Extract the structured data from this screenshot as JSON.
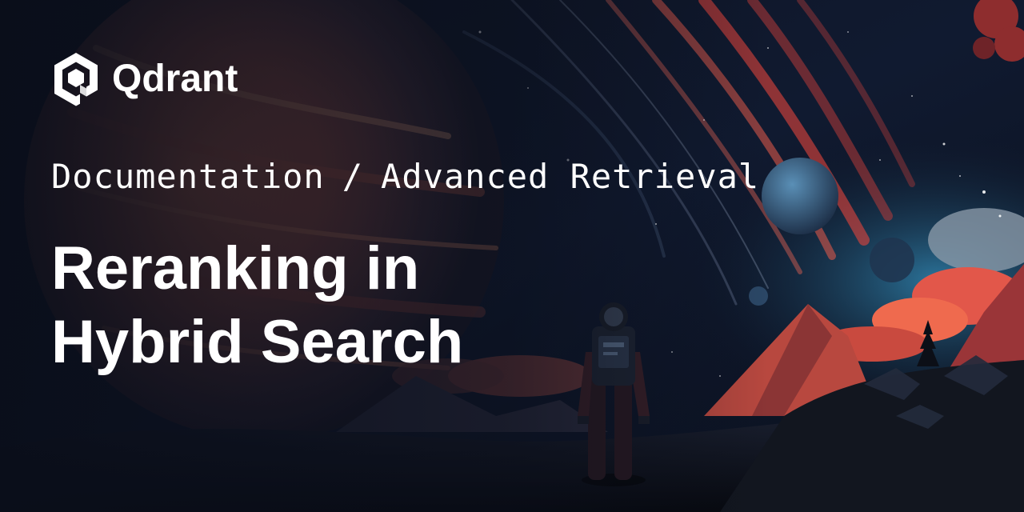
{
  "brand": {
    "name": "Qdrant",
    "logo_icon": "qdrant-hexagon-logo-icon"
  },
  "breadcrumb": {
    "section": "Documentation",
    "separator": "/",
    "page": "Advanced Retrieval"
  },
  "title": {
    "line1": "Reranking in",
    "line2": "Hybrid Search"
  },
  "illustration": {
    "icon": "astronaut-alien-planet-illustration"
  },
  "colors": {
    "background": "#0b1020",
    "text": "#ffffff",
    "accent_red": "#e2453c",
    "sky_blue": "#2a6f95"
  }
}
